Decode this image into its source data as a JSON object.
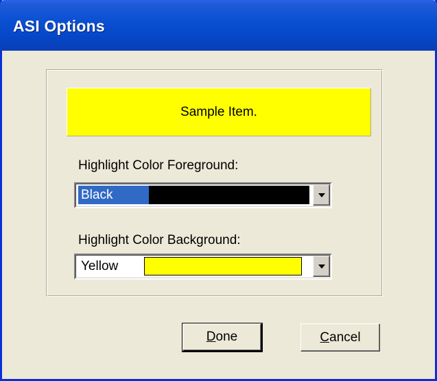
{
  "window": {
    "title": "ASI Options"
  },
  "sample": {
    "text": "Sample Item.",
    "background": "#ffff00",
    "foreground": "#000000"
  },
  "foreground": {
    "label": "Highlight Color Foreground:",
    "selected": "Black",
    "swatch_color": "#000000",
    "selection_highlight": "#316ac5"
  },
  "background": {
    "label": "Highlight Color Background:",
    "selected": "Yellow",
    "swatch_color": "#ffff00"
  },
  "buttons": {
    "done_mnemonic": "D",
    "done_rest": "one",
    "cancel_mnemonic": "C",
    "cancel_rest": "ancel"
  },
  "icons": {
    "dropdown": "chevron-down-icon"
  },
  "colors": {
    "title_bar": "#0b50d3",
    "dialog_bg": "#ece9d8"
  }
}
